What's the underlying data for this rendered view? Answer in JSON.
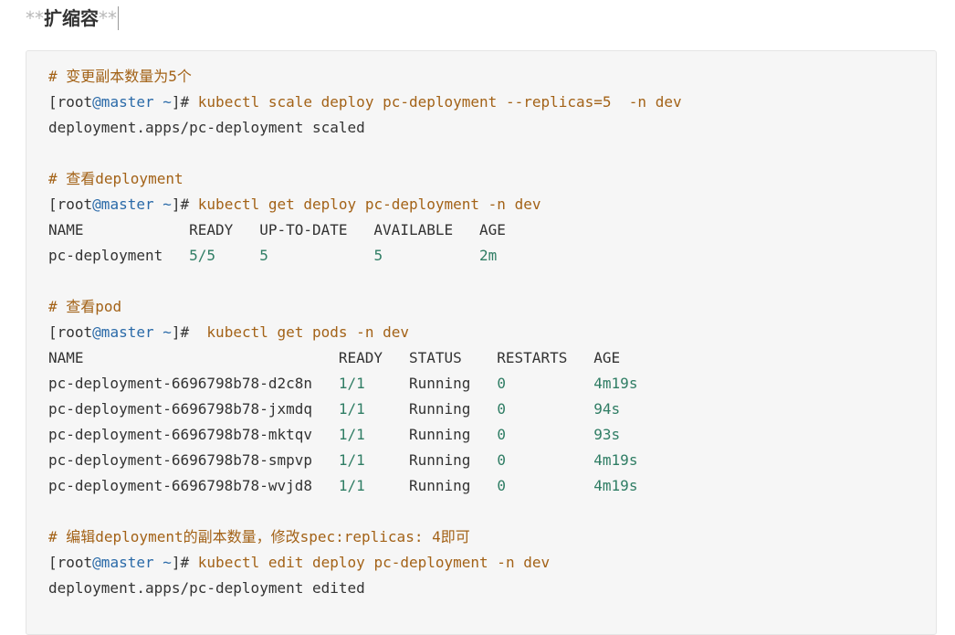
{
  "heading": {
    "md_prefix": "**",
    "text": "扩缩容",
    "md_suffix": "**"
  },
  "blocks": [
    {
      "comment": "# 变更副本数量为5个",
      "prompt": {
        "open": "[root",
        "at_host": "@master",
        "path_close": " ~]#",
        "command": " kubectl scale deploy pc-deployment --replicas=5  -n dev"
      },
      "output": [
        "deployment.apps/pc-deployment scaled"
      ]
    },
    {
      "comment": "# 查看deployment",
      "prompt": {
        "open": "[root",
        "at_host": "@master",
        "path_close": " ~]#",
        "command": " kubectl get deploy pc-deployment -n dev"
      },
      "table": {
        "header": "NAME            READY   UP-TO-DATE   AVAILABLE   AGE",
        "rows": [
          {
            "name": "pc-deployment   ",
            "ready": "5/5",
            "gap1": "     ",
            "uptodate": "5",
            "gap2": "            ",
            "available": "5",
            "gap3": "           ",
            "age": "2m"
          }
        ]
      }
    },
    {
      "comment": "# 查看pod",
      "prompt": {
        "open": "[root",
        "at_host": "@master",
        "path_close": " ~]#",
        "command": "  kubectl get pods -n dev"
      },
      "pods": {
        "header": "NAME                             READY   STATUS    RESTARTS   AGE",
        "rows": [
          {
            "name": "pc-deployment-6696798b78-d2c8n   ",
            "ready": "1/1",
            "gap1": "     ",
            "status": "Running",
            "gap2": "   ",
            "restarts": "0",
            "gap3": "          ",
            "age": "4m19s"
          },
          {
            "name": "pc-deployment-6696798b78-jxmdq   ",
            "ready": "1/1",
            "gap1": "     ",
            "status": "Running",
            "gap2": "   ",
            "restarts": "0",
            "gap3": "          ",
            "age": "94s"
          },
          {
            "name": "pc-deployment-6696798b78-mktqv   ",
            "ready": "1/1",
            "gap1": "     ",
            "status": "Running",
            "gap2": "   ",
            "restarts": "0",
            "gap3": "          ",
            "age": "93s"
          },
          {
            "name": "pc-deployment-6696798b78-smpvp   ",
            "ready": "1/1",
            "gap1": "     ",
            "status": "Running",
            "gap2": "   ",
            "restarts": "0",
            "gap3": "          ",
            "age": "4m19s"
          },
          {
            "name": "pc-deployment-6696798b78-wvjd8   ",
            "ready": "1/1",
            "gap1": "     ",
            "status": "Running",
            "gap2": "   ",
            "restarts": "0",
            "gap3": "          ",
            "age": "4m19s"
          }
        ]
      }
    },
    {
      "comment": "# 编辑deployment的副本数量，修改spec:replicas: 4即可",
      "prompt": {
        "open": "[root",
        "at_host": "@master",
        "path_close": " ~]#",
        "command": " kubectl edit deploy pc-deployment -n dev"
      },
      "output": [
        "deployment.apps/pc-deployment edited"
      ]
    }
  ],
  "colors": {
    "comment": "#a36217",
    "host": "#2a6aa8",
    "number": "#2f7d64",
    "text": "#333333",
    "code_bg": "#f6f6f6"
  }
}
